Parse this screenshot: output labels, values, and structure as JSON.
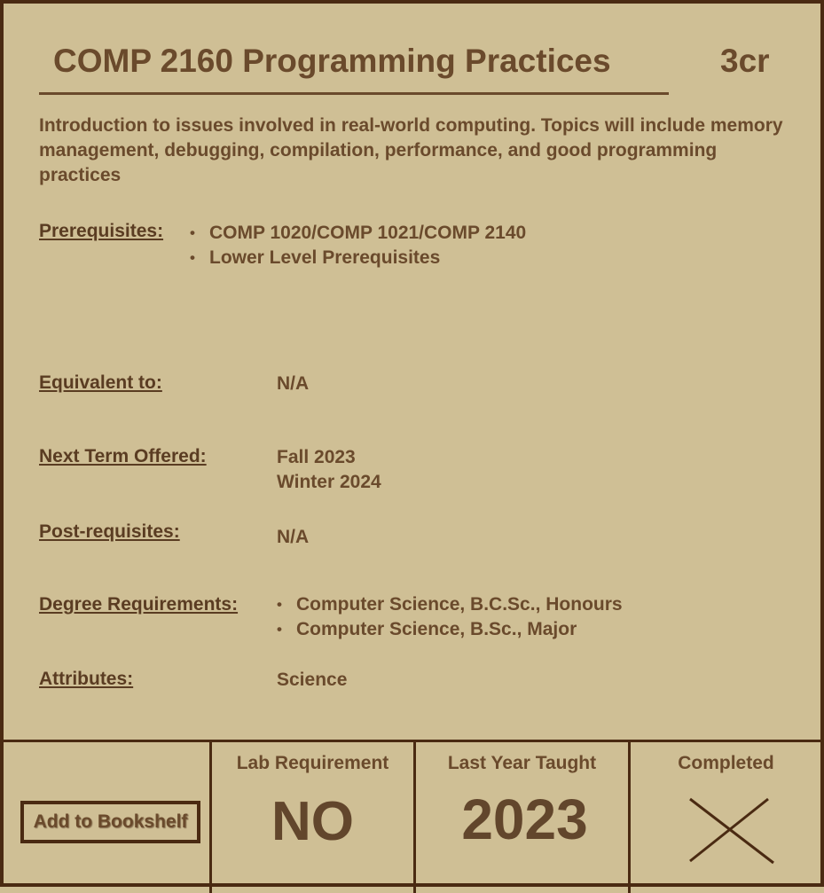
{
  "course": {
    "title": "COMP 2160 Programming Practices",
    "credits": "3cr",
    "description": "Introduction to issues involved in real-world computing. Topics will include memory management, debugging, compilation, performance, and good programming practices"
  },
  "details": {
    "prerequisites_label": "Prerequisites:",
    "prerequisites": [
      "COMP 1020/COMP 1021/COMP 2140",
      "Lower Level Prerequisites"
    ],
    "equivalent_label": "Equivalent to:",
    "equivalent_value": "N/A",
    "next_term_label": "Next Term Offered:",
    "next_terms": [
      "Fall 2023",
      "Winter 2024"
    ],
    "postreq_label": "Post-requisites:",
    "postreq_value": "N/A",
    "degree_label": "Degree Requirements:",
    "degrees": [
      "Computer Science, B.C.Sc., Honours",
      "Computer Science, B.Sc., Major"
    ],
    "attributes_label": "Attributes:",
    "attributes_value": "Science"
  },
  "footer": {
    "bookshelf_button": "Add to Bookshelf",
    "lab_title": "Lab Requirement",
    "lab_value": "NO",
    "last_year_title": "Last Year Taught",
    "last_year_value": "2023",
    "completed_title": "Completed",
    "completed_icon": "x-mark-icon"
  },
  "colors": {
    "background": "#cfbf95",
    "border": "#4a2a12",
    "text": "#6a4a2c"
  }
}
